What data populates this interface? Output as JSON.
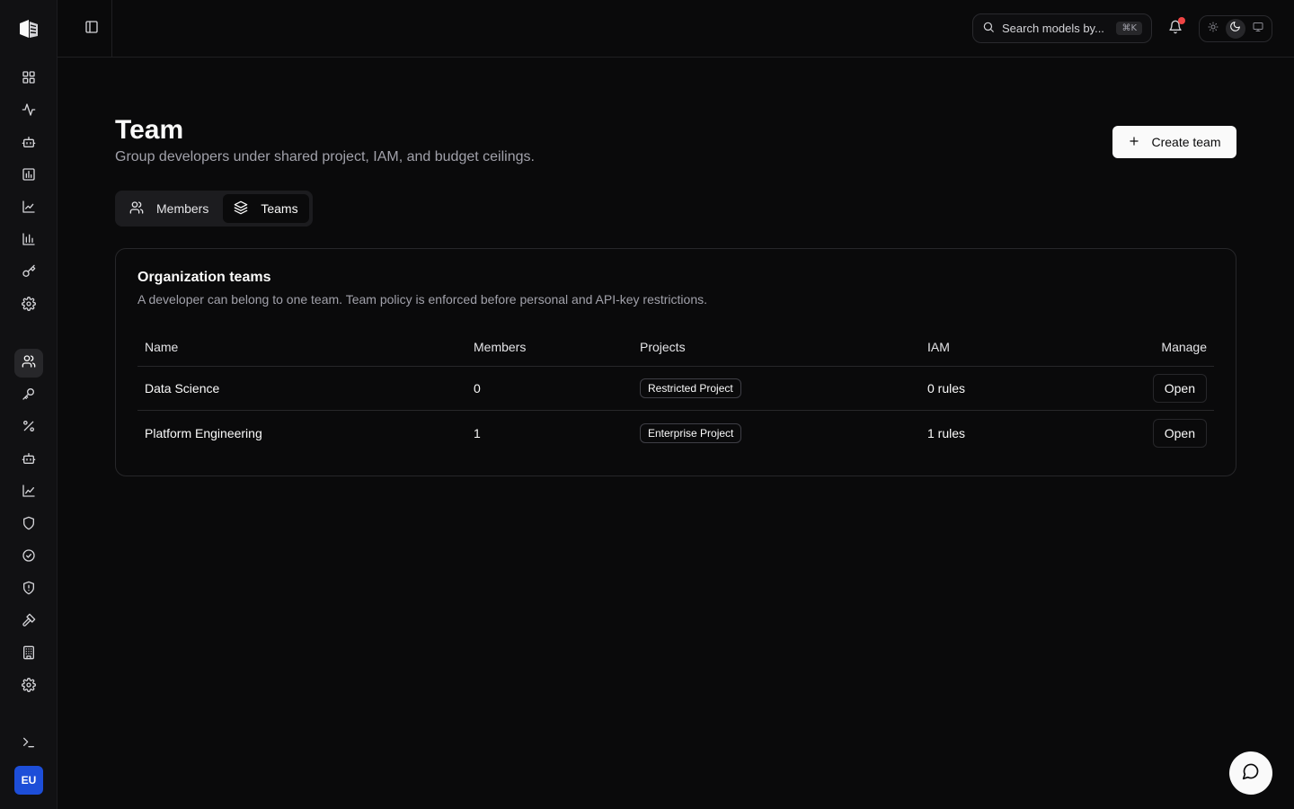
{
  "topbar": {
    "search_placeholder": "Search models by...",
    "search_shortcut": "⌘K",
    "theme_options": [
      "light",
      "dark",
      "system"
    ],
    "theme_selected": "dark"
  },
  "sidebar": {
    "items": [
      {
        "icon": "dashboard-icon"
      },
      {
        "icon": "activity-icon"
      },
      {
        "icon": "bot-icon"
      },
      {
        "icon": "bar-chart-icon"
      },
      {
        "icon": "line-chart-icon"
      },
      {
        "icon": "column-chart-icon"
      },
      {
        "icon": "key-icon"
      },
      {
        "icon": "settings-icon"
      },
      {
        "icon": "users-icon",
        "active": true
      },
      {
        "icon": "key-round-icon"
      },
      {
        "icon": "percent-icon"
      },
      {
        "icon": "bot-icon"
      },
      {
        "icon": "trend-chart-icon"
      },
      {
        "icon": "shield-icon"
      },
      {
        "icon": "check-circle-icon"
      },
      {
        "icon": "shield-alert-icon"
      },
      {
        "icon": "hammer-icon"
      },
      {
        "icon": "building-icon"
      },
      {
        "icon": "settings-icon"
      },
      {
        "icon": "terminal-icon"
      }
    ],
    "avatar_initials": "EU"
  },
  "page": {
    "title": "Team",
    "subtitle": "Group developers under shared project, IAM, and budget ceilings.",
    "create_label": "Create team"
  },
  "tabs": [
    {
      "label": "Members",
      "icon": "users-icon",
      "active": false
    },
    {
      "label": "Teams",
      "icon": "layers-icon",
      "active": true
    }
  ],
  "card": {
    "title": "Organization teams",
    "description": "A developer can belong to one team. Team policy is enforced before personal and API-key restrictions."
  },
  "table": {
    "headers": {
      "name": "Name",
      "members": "Members",
      "projects": "Projects",
      "iam": "IAM",
      "manage": "Manage"
    },
    "rows": [
      {
        "name": "Data Science",
        "members": "0",
        "project": "Restricted Project",
        "iam": "0 rules",
        "action": "Open"
      },
      {
        "name": "Platform Engineering",
        "members": "1",
        "project": "Enterprise Project",
        "iam": "1 rules",
        "action": "Open"
      }
    ]
  },
  "colors": {
    "background": "#0a0a0b",
    "sidebar": "#111113",
    "avatar": "#1d4ed8",
    "notification_dot": "#ef4444"
  }
}
